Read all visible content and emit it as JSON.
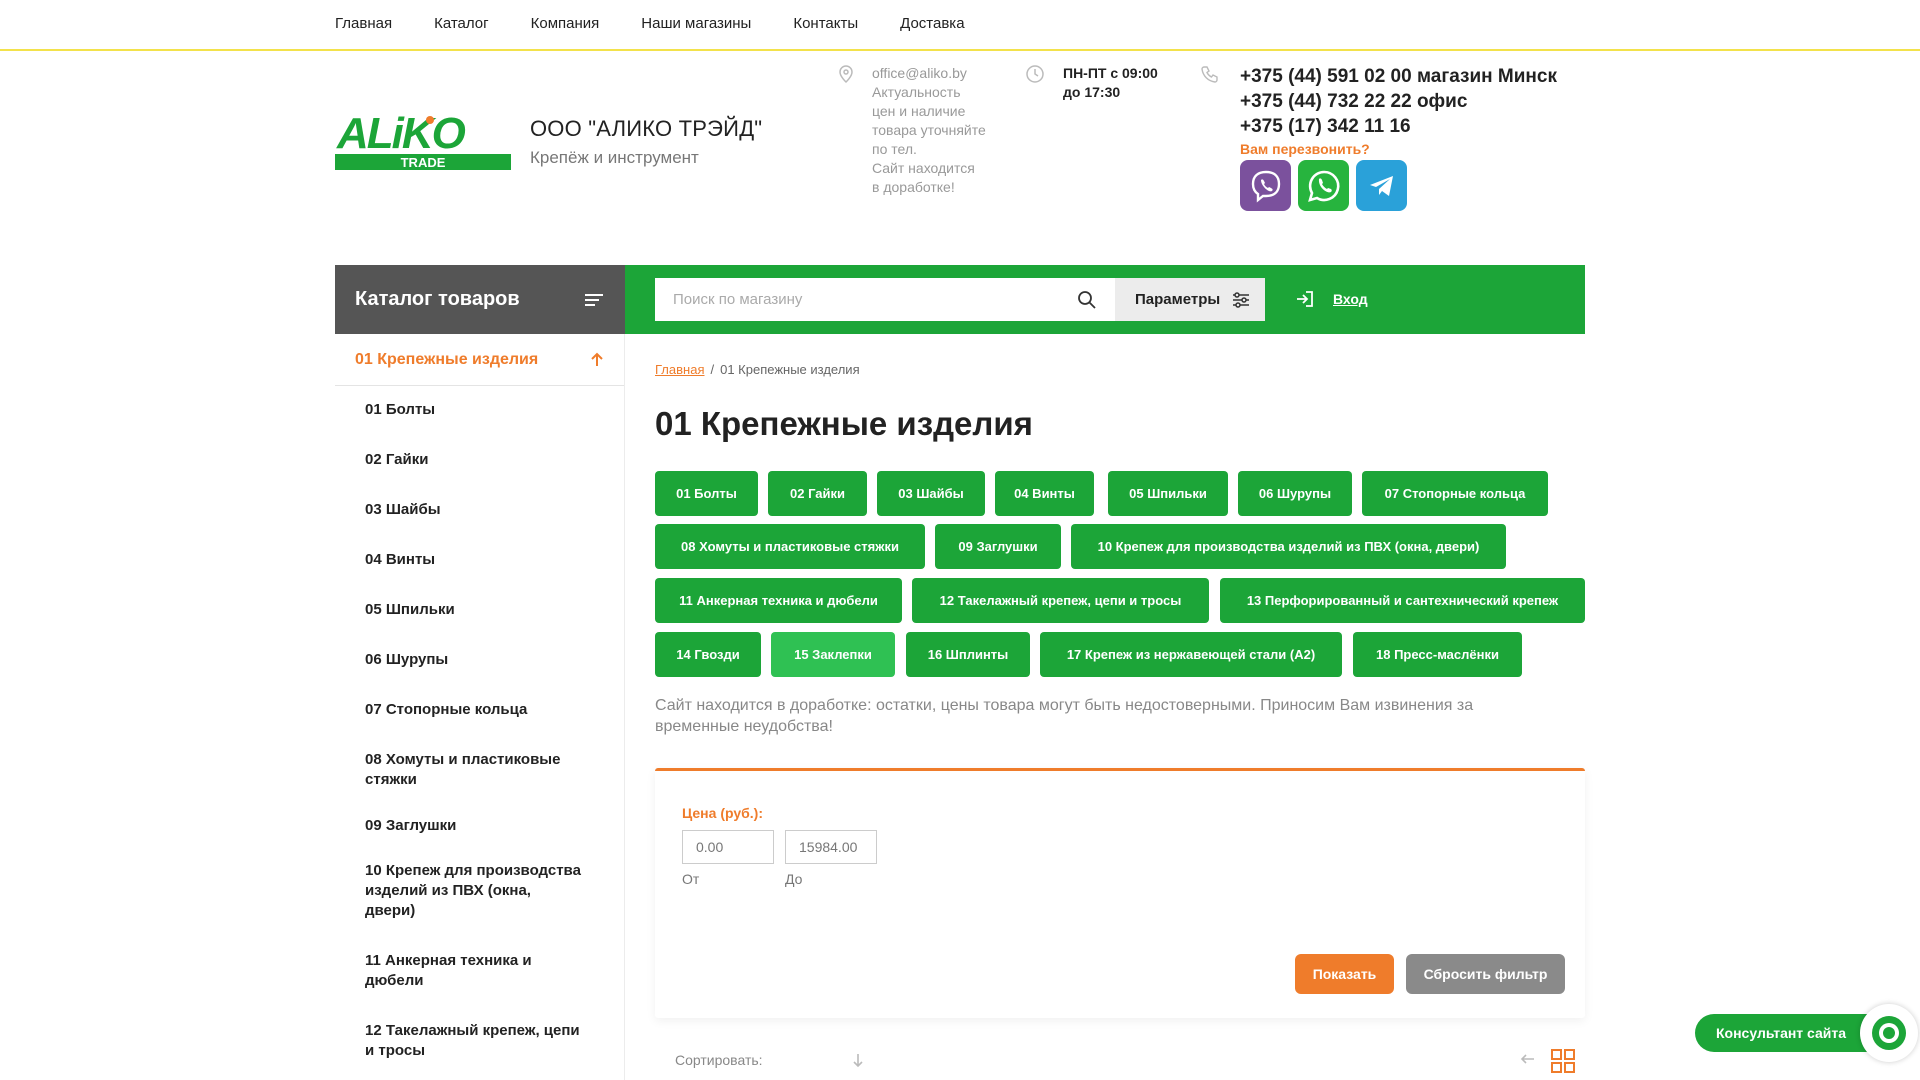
{
  "topnav": [
    "Главная",
    "Каталог",
    "Компания",
    "Наши магазины",
    "Контакты",
    "Доставка"
  ],
  "logo": {
    "main": "ALiKO",
    "sub": "TRADE"
  },
  "company": {
    "name": "ООО \"АЛИКО ТРЭЙД\"",
    "tagline": "Крепёж и инструмент"
  },
  "contacts": {
    "email": "office@aliko.by",
    "email_note": [
      "Актуальность",
      "цен и наличие",
      "товара уточняйте",
      "по тел.",
      "Сайт находится",
      "в доработке!"
    ],
    "hours": [
      "ПН-ПТ с 09:00",
      "до 17:30"
    ],
    "phones": [
      "+375 (44) 591 02 00 магазин Минск",
      "+375 (44) 732 22 22 офис",
      "+375 (17) 342 11 16"
    ],
    "callback": "Вам перезвонить?"
  },
  "messengers": [
    {
      "name": "viber",
      "color": "#7b519d"
    },
    {
      "name": "whatsapp",
      "color": "#27b43e"
    },
    {
      "name": "telegram",
      "color": "#2aa1d9"
    }
  ],
  "catalog_bar": {
    "title": "Каталог товаров"
  },
  "search": {
    "placeholder": "Поиск по магазину",
    "params_label": "Параметры"
  },
  "login_label": "Вход",
  "sidebar": {
    "active": "01 Крепежные изделия",
    "items": [
      "01 Болты",
      "02 Гайки",
      "03 Шайбы",
      "04 Винты",
      "05 Шпильки",
      "06 Шурупы",
      "07 Стопорные кольца",
      "08 Хомуты и пластиковые стяжки",
      "09 Заглушки",
      "10 Крепеж для производства изделий из ПВХ (окна, двери)",
      "11 Анкерная техника и дюбели",
      "12 Такелажный крепеж, цепи и тросы"
    ]
  },
  "breadcrumb": {
    "home": "Главная",
    "sep": "/",
    "current": "01 Крепежные изделия"
  },
  "page_title": "01 Крепежные изделия",
  "chips": [
    "01 Болты",
    "02 Гайки",
    "03 Шайбы",
    "04 Винты",
    "05 Шпильки",
    "06 Шурупы",
    "07 Стопорные кольца",
    "08 Хомуты и пластиковые стяжки",
    "09 Заглушки",
    "10 Крепеж для производства изделий из ПВХ (окна, двери)",
    "11 Анкерная техника и дюбели",
    "12 Такелажный крепеж, цепи и тросы",
    "13 Перфорированный и сантехнический крепеж",
    "14 Гвозди",
    "15 Заклепки",
    "16 Шплинты",
    "17 Крепеж из нержавеющей стали (А2)",
    "18 Пресс-маслёнки"
  ],
  "active_chip": "15 Заклепки",
  "notice": "Сайт находится в доработке: остатки, цены товара могут быть недостоверными. Приносим Вам извинения за временные неудобства!",
  "filter": {
    "label": "Цена (руб.):",
    "from_value": "0.00",
    "to_value": "15984.00",
    "from_label": "От",
    "to_label": "До",
    "show_label": "Показать",
    "reset_label": "Сбросить фильтр"
  },
  "sort_label": "Сортировать:",
  "consultant_label": "Консультант сайта",
  "colors": {
    "green": "#1ca538",
    "orange": "#ef7c2b",
    "dark": "#555555"
  }
}
